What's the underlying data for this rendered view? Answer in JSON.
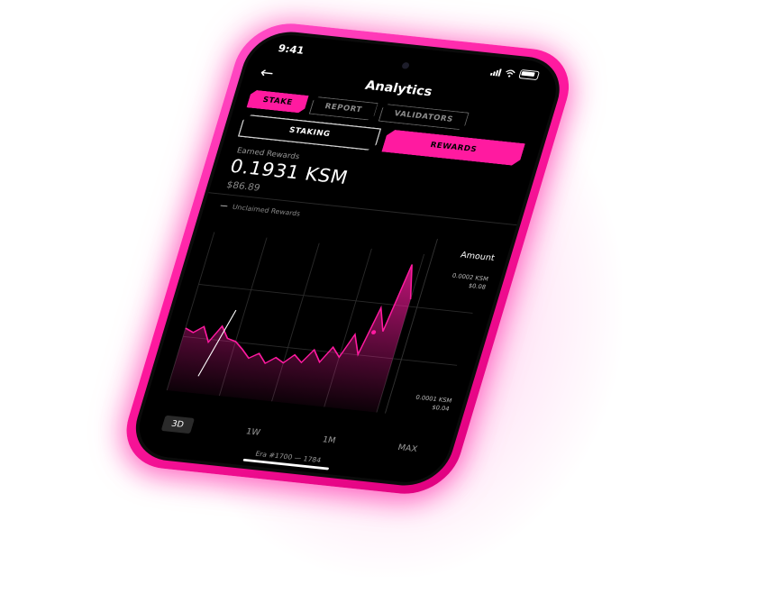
{
  "status_bar": {
    "time": "9:41"
  },
  "nav": {
    "title": "Analytics"
  },
  "tabs_primary": [
    {
      "label": "Stake",
      "active": true
    },
    {
      "label": "Report",
      "active": false
    },
    {
      "label": "Validators",
      "active": false
    }
  ],
  "tabs_secondary": [
    {
      "label": "Staking",
      "active": false
    },
    {
      "label": "Rewards",
      "active": true
    }
  ],
  "rewards": {
    "earned_label": "Earned Rewards",
    "value": "0.1931 KSM",
    "fiat": "$86.89",
    "legend": "Unclaimed Rewards"
  },
  "chart": {
    "amount_label": "Amount",
    "y_top_ksm": "0.0002 KSM",
    "y_top_fiat": "$0.08",
    "y_bottom_ksm": "0.0001 KSM",
    "y_bottom_fiat": "$0.04"
  },
  "periods": [
    {
      "label": "3D",
      "active": true
    },
    {
      "label": "1W",
      "active": false
    },
    {
      "label": "1M",
      "active": false
    },
    {
      "label": "MAX",
      "active": false
    }
  ],
  "era_range": "Era #1700 — 1784",
  "colors": {
    "accent": "#ff1aa0",
    "background": "#000000"
  },
  "chart_data": {
    "type": "area",
    "series": [
      {
        "values": [
          0.000115,
          0.000112,
          0.000118,
          0.000105,
          0.00012,
          0.00011,
          0.000108,
          0.000102,
          9.5e-05,
          0.0001,
          9.2e-05,
          9.8e-05,
          9.4e-05,
          0.000102,
          9.6e-05,
          0.000108,
          9.8e-05,
          0.000112,
          0.000104,
          0.000125,
          0.000108,
          0.00015,
          0.00013,
          0.00019,
          0.00016
        ]
      }
    ],
    "highlight": {
      "values": [
        7.5e-05,
        0.000135
      ]
    },
    "ylim": [
      6e-05,
      0.0002
    ]
  }
}
